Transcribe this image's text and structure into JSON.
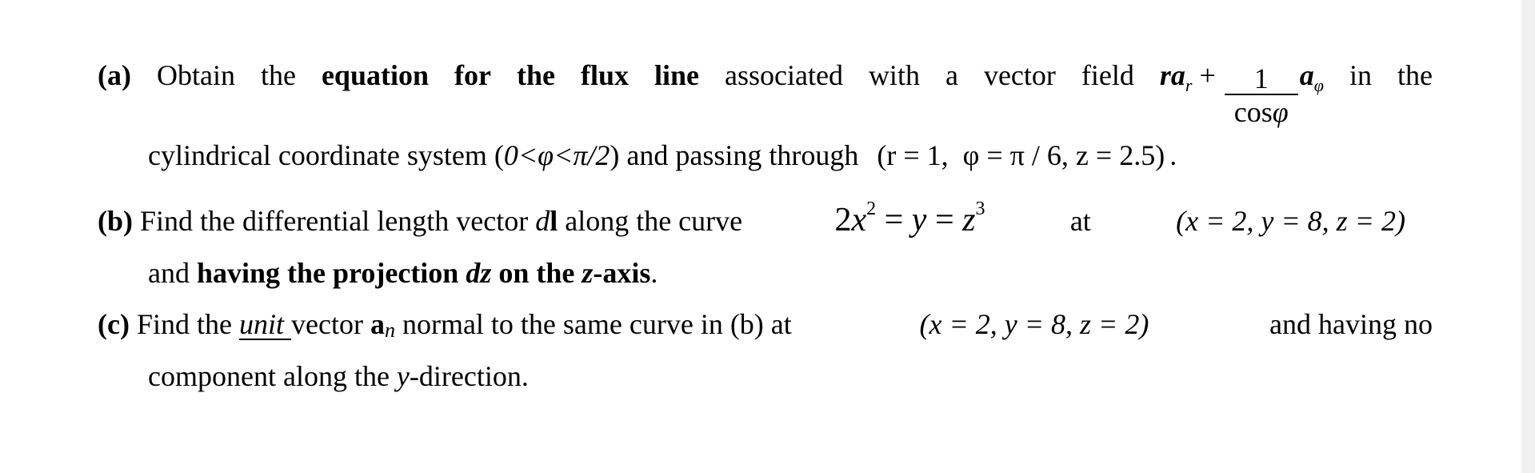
{
  "document": {
    "part_a": {
      "label": "(a)",
      "text1": " Obtain the ",
      "bold1": "equation for the flux line",
      "text2": " associated with a vector field ",
      "field": {
        "r": "r",
        "a": "a",
        "a_sub_r": "r",
        "plus": " + ",
        "frac_num": "1",
        "frac_den_cos": "cos",
        "frac_den_phi": "φ",
        "a2": "a",
        "a_sub_phi": "φ"
      },
      "text3": "in the",
      "line2_text1": "cylindrical coordinate system (",
      "range": "0<φ<π/2",
      "line2_text2": ") and passing through ",
      "point": "(r = 1,  φ = π / 6, z = 2.5)",
      "line2_end": "."
    },
    "part_b": {
      "label": "(b)",
      "text1": " Find the differential length vector ",
      "dl_d": "d",
      "dl_l": "l",
      "text2": " along the curve ",
      "curve": {
        "lhs_coef": "2",
        "x": "x",
        "x_exp": "2",
        "eq1": " = ",
        "y": "y",
        "eq2": " = ",
        "z": "z",
        "z_exp": "3"
      },
      "text3": "at",
      "point": "(x = 2, y = 8, z = 2)",
      "line2_text1": "and ",
      "line2_bold1": "having the projection ",
      "line2_bolditalic": "dz",
      "line2_bold2": " on the ",
      "line2_bolditalic2": "z",
      "line2_bold3": "-axis",
      "line2_end": "."
    },
    "part_c": {
      "label": "(c)",
      "text1": " Find the ",
      "unit_underlined": "unit ",
      "text2": "vector ",
      "an_a": "a",
      "an_n": "n",
      "text3": " normal to the same curve in (b) at ",
      "point": "(x = 2, y = 8, z = 2)",
      "text4": "and having no",
      "line2_text1": "component along the ",
      "line2_italic": "y",
      "line2_text2": "-direction."
    }
  }
}
